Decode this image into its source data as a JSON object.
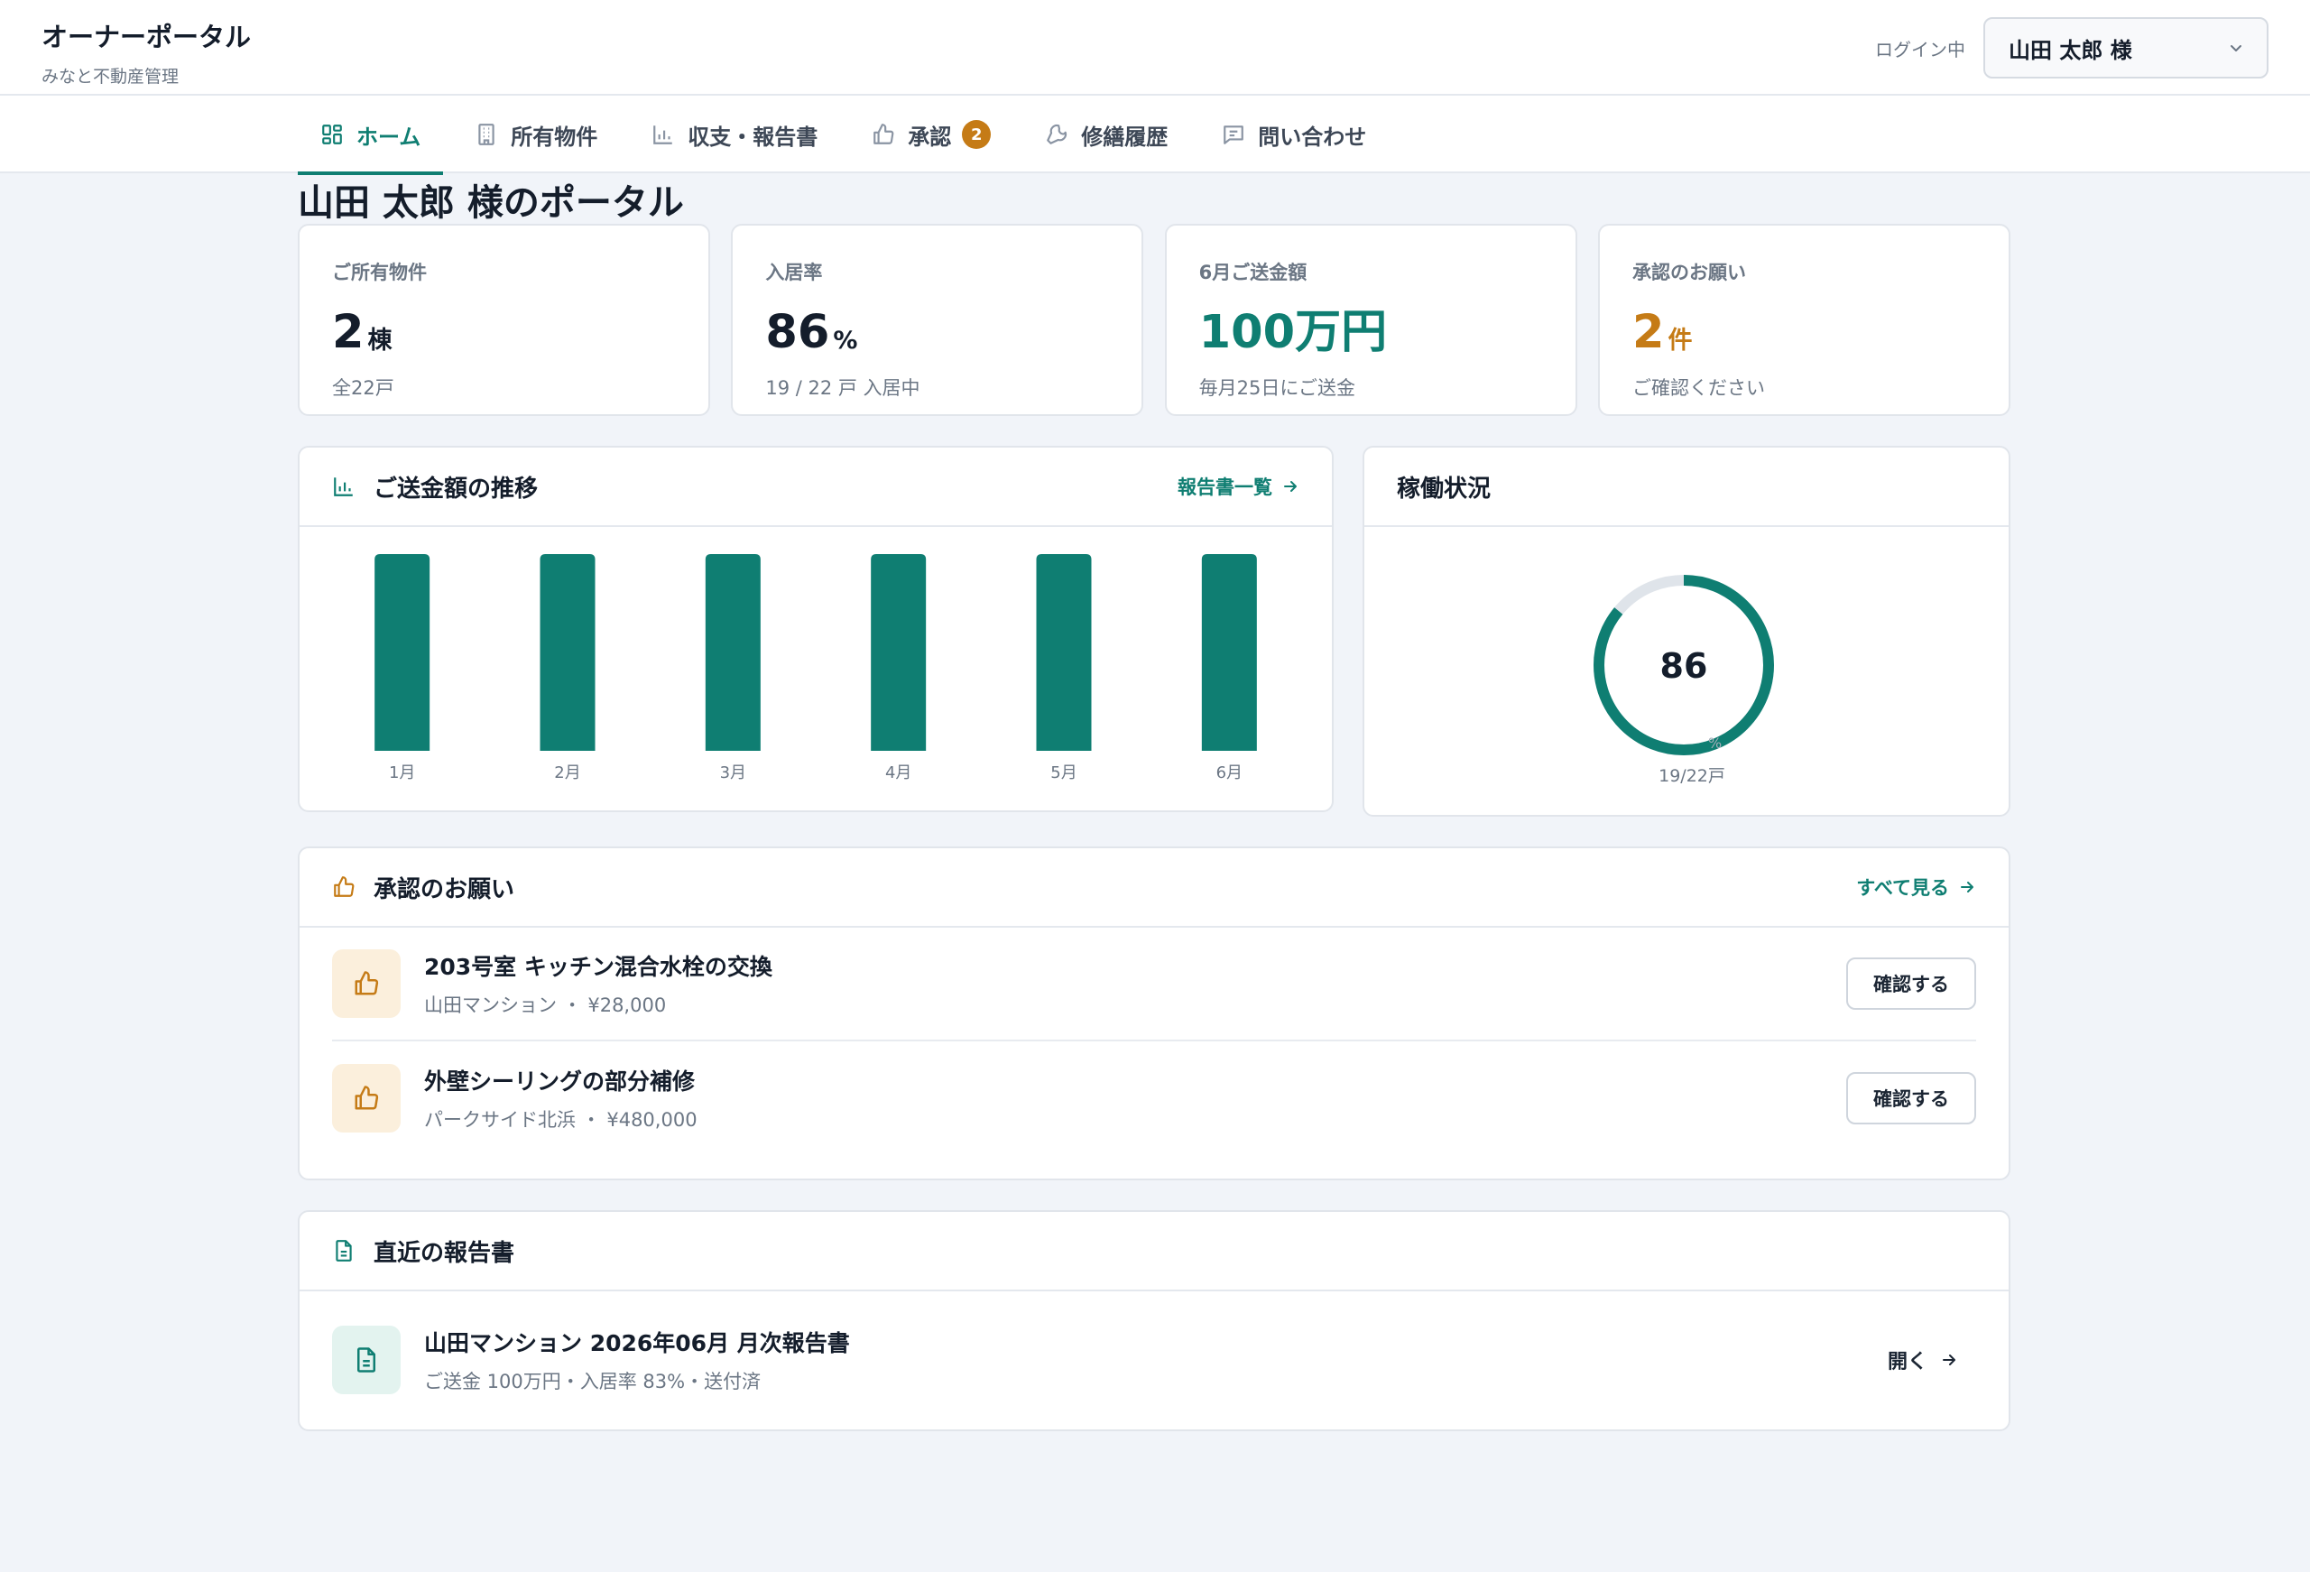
{
  "brand": {
    "title": "オーナーポータル",
    "subtitle": "みなと不動産管理"
  },
  "header": {
    "login_label": "ログイン中",
    "user_name": "山田 太郎 様"
  },
  "nav": {
    "tabs": [
      {
        "label": "ホーム",
        "icon": "dashboard-icon"
      },
      {
        "label": "所有物件",
        "icon": "building-icon"
      },
      {
        "label": "収支・報告書",
        "icon": "bar-chart-icon"
      },
      {
        "label": "承認",
        "icon": "thumbs-up-icon",
        "badge": "2"
      },
      {
        "label": "修繕履歴",
        "icon": "wrench-icon"
      },
      {
        "label": "問い合わせ",
        "icon": "message-icon"
      }
    ],
    "active_index": 0
  },
  "page": {
    "title": "山田 太郎 様のポータル"
  },
  "stats": [
    {
      "label": "ご所有物件",
      "value": "2",
      "unit": "棟",
      "sub": "全22戸"
    },
    {
      "label": "入居率",
      "value": "86",
      "unit": "%",
      "sub": "19 / 22 戸 入居中"
    },
    {
      "label": "6月ご送金額",
      "value": "100万円",
      "unit": "",
      "sub": "毎月25日にご送金"
    },
    {
      "label": "承認のお願い",
      "value": "2",
      "unit": "件",
      "sub": "ご確認ください"
    }
  ],
  "remit_card": {
    "title": "ご送金額の推移",
    "link": "報告書一覧"
  },
  "chart_data": {
    "type": "bar",
    "categories": [
      "1月",
      "2月",
      "3月",
      "4月",
      "5月",
      "6月"
    ],
    "values": [
      100,
      100,
      100,
      100,
      100,
      100
    ],
    "ylim": [
      0,
      100
    ],
    "grid": false,
    "color": "#0f7e72"
  },
  "occupancy_card": {
    "title": "稼働状況",
    "value": "86",
    "unit": "%",
    "percent": 86,
    "caption": "19/22戸"
  },
  "approvals": {
    "title": "承認のお願い",
    "link": "すべて見る",
    "items": [
      {
        "title": "203号室 キッチン混合水栓の交換",
        "meta": "山田マンション ・ ¥28,000",
        "button": "確認する"
      },
      {
        "title": "外壁シーリングの部分補修",
        "meta": "パークサイド北浜 ・ ¥480,000",
        "button": "確認する"
      }
    ]
  },
  "reports": {
    "title": "直近の報告書",
    "items": [
      {
        "title": "山田マンション 2026年06月 月次報告書",
        "meta": "ご送金 100万円・入居率 83%・送付済",
        "action": "開く"
      }
    ]
  },
  "colors": {
    "accent": "#0f7e72",
    "warning": "#c57b16",
    "background": "#f1f4f9"
  }
}
